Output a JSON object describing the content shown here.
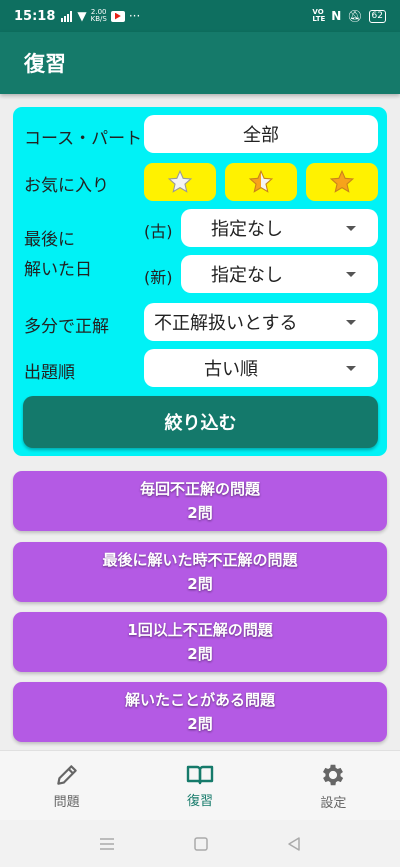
{
  "status_bar": {
    "time": "15:18",
    "network_speed_top": "2.00",
    "network_speed_unit": "KB/S",
    "more": "···",
    "volte_top": "VO",
    "volte_bottom": "LTE",
    "nfc": "N",
    "battery": "62"
  },
  "app_bar": {
    "title": "復習"
  },
  "filter": {
    "course_label": "コース・パート",
    "course_value": "全部",
    "favorite_label": "お気に入り",
    "last_solved_label_line1": "最後に",
    "last_solved_label_line2": "解いた日",
    "old_label": "(古)",
    "old_value": "指定なし",
    "new_label": "(新)",
    "new_value": "指定なし",
    "mostly_correct_label": "多分で正解",
    "mostly_correct_value": "不正解扱いとする",
    "order_label": "出題順",
    "order_value": "古い順",
    "apply_label": "絞り込む"
  },
  "review_lists": [
    {
      "title": "毎回不正解の問題",
      "count": "2問"
    },
    {
      "title": "最後に解いた時不正解の問題",
      "count": "2問"
    },
    {
      "title": "1回以上不正解の問題",
      "count": "2問"
    },
    {
      "title": "解いたことがある問題",
      "count": "2問"
    }
  ],
  "bottom_nav": {
    "problems": "問題",
    "review": "復習",
    "settings": "設定"
  },
  "colors": {
    "primary": "#157a6a",
    "filter_panel": "#00f2f6",
    "star_button": "#fff200",
    "review_card": "#b45ae4"
  },
  "icons": {
    "nav_problems": "pencil-icon",
    "nav_review": "book-icon",
    "nav_settings": "gear-icon",
    "favorite": "star-icon"
  }
}
